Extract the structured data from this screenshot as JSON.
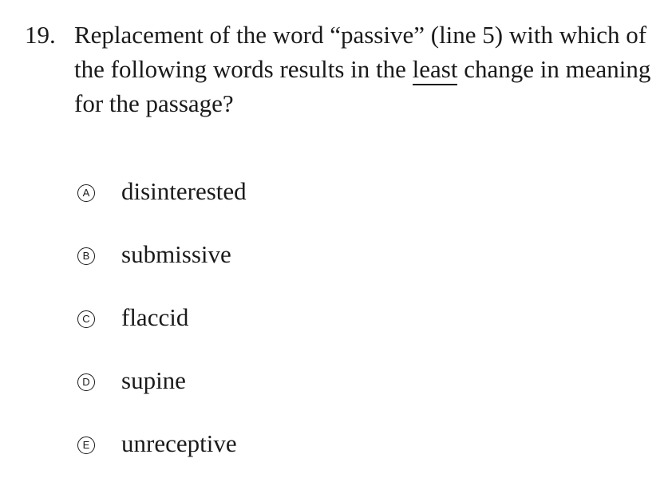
{
  "question": {
    "number": "19.",
    "text_before": "Replacement of the word “passive” (line 5) with which of the following words results in the ",
    "emphasis": "least",
    "text_after": " change in meaning for the passage?"
  },
  "choices": [
    {
      "letter": "A",
      "text": "disinterested"
    },
    {
      "letter": "B",
      "text": "submissive"
    },
    {
      "letter": "C",
      "text": "flaccid"
    },
    {
      "letter": "D",
      "text": "supine"
    },
    {
      "letter": "E",
      "text": "unreceptive"
    }
  ]
}
